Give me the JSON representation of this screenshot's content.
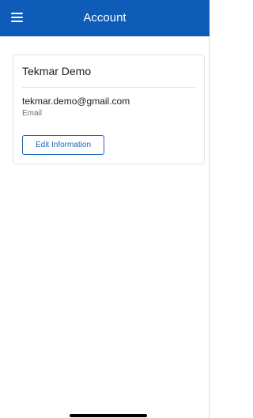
{
  "header": {
    "title": "Account",
    "menu_icon": "hamburger-menu-icon"
  },
  "account": {
    "name": "Tekmar Demo",
    "email": "tekmar.demo@gmail.com",
    "email_label": "Email",
    "edit_label": "Edit Information"
  },
  "colors": {
    "header_background": "#0f5bb8",
    "accent": "#1f62bd"
  }
}
